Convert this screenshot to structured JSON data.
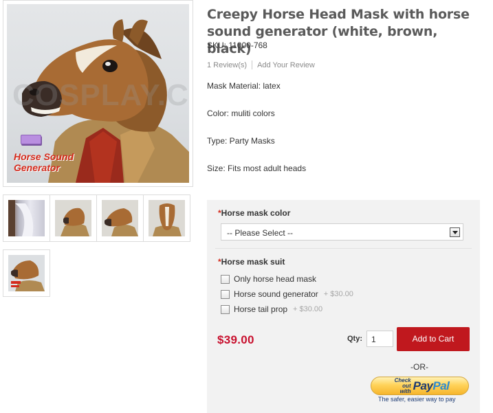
{
  "product": {
    "title": "Creepy Horse Head Mask with horse sound generator (white, brown, black)",
    "sku": "SKU: 11000-768",
    "reviews_link": "1 Review(s)",
    "add_review_link": "Add Your Review",
    "attributes": [
      "Mask Material: latex",
      "Color: muliti colors",
      "Type: Party Masks",
      "Size: Fits most adult heads"
    ]
  },
  "gallery": {
    "watermark": "COSPLAY.C",
    "caption": "Horse Sound Generator",
    "thumbnails": [
      "horse-tail",
      "horse-head-side",
      "horse-head-profile",
      "horse-head-front",
      "horse-head-generator"
    ]
  },
  "options": {
    "color": {
      "required_mark": "*",
      "label": "Horse mask color",
      "selected": "-- Please Select --"
    },
    "suit": {
      "required_mark": "*",
      "label": "Horse mask suit",
      "choices": [
        {
          "label": "Only horse head mask",
          "price": ""
        },
        {
          "label": "Horse sound generator",
          "price": "+ $30.00"
        },
        {
          "label": "Horse tail prop",
          "price": "+ $30.00"
        }
      ]
    }
  },
  "purchase": {
    "price": "$39.00",
    "qty_label": "Qty:",
    "qty_value": "1",
    "add_to_cart": "Add to Cart",
    "or_text": "-OR-",
    "paypal_checkout": "Check out with",
    "paypal_logo_pay": "Pay",
    "paypal_logo_pal": "Pal",
    "paypal_tagline": "The safer, easier way to pay"
  },
  "colors": {
    "price_red": "#c8102e",
    "cart_button": "#c0181e",
    "panel_bg": "#f2f2f2",
    "paypal_gold": "#ffd35a"
  }
}
